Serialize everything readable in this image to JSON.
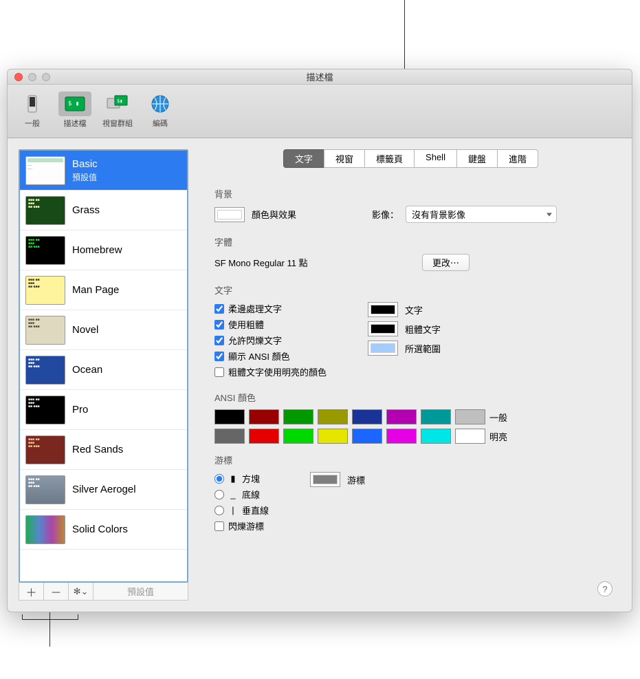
{
  "window_title": "描述檔",
  "toolbar": {
    "items": [
      {
        "label": "一般"
      },
      {
        "label": "描述檔"
      },
      {
        "label": "視窗群組"
      },
      {
        "label": "編碼"
      }
    ]
  },
  "sidebar": {
    "items": [
      {
        "name": "Basic",
        "sub": "預設值",
        "thumb": "basic"
      },
      {
        "name": "Grass",
        "thumb": "grass"
      },
      {
        "name": "Homebrew",
        "thumb": "homebrew"
      },
      {
        "name": "Man Page",
        "thumb": "manpage"
      },
      {
        "name": "Novel",
        "thumb": "novel"
      },
      {
        "name": "Ocean",
        "thumb": "ocean"
      },
      {
        "name": "Pro",
        "thumb": "pro"
      },
      {
        "name": "Red Sands",
        "thumb": "redsands"
      },
      {
        "name": "Silver Aerogel",
        "thumb": "silver"
      },
      {
        "name": "Solid Colors",
        "thumb": "solid"
      }
    ],
    "footer_default": "預設值"
  },
  "tabs": [
    "文字",
    "視窗",
    "標籤頁",
    "Shell",
    "鍵盤",
    "進階"
  ],
  "sections": {
    "background": {
      "title": "背景",
      "color_label": "顏色與效果",
      "image_label": "影像：",
      "image_value": "沒有背景影像"
    },
    "font": {
      "title": "字體",
      "value": "SF Mono Regular 11 點",
      "change": "更改⋯"
    },
    "text": {
      "title": "文字",
      "opts": [
        "柔邊處理文字",
        "使用粗體",
        "允許閃爍文字",
        "顯示 ANSI 顏色",
        "粗體文字使用明亮的顏色"
      ],
      "wells": [
        "文字",
        "粗體文字",
        "所選範圍"
      ]
    },
    "ansi": {
      "title": "ANSI 顏色",
      "normal_label": "一般",
      "bright_label": "明亮",
      "normal": [
        "#000000",
        "#990000",
        "#009900",
        "#999900",
        "#1a3399",
        "#b300b3",
        "#009999",
        "#bfbfbf"
      ],
      "bright": [
        "#666666",
        "#e50000",
        "#00d900",
        "#e5e500",
        "#1a66ff",
        "#e500e5",
        "#00e5e5",
        "#ffffff"
      ]
    },
    "cursor": {
      "title": "游標",
      "opts": [
        "方塊",
        "底線",
        "垂直線"
      ],
      "blink": "閃爍游標",
      "well": "游標"
    }
  }
}
